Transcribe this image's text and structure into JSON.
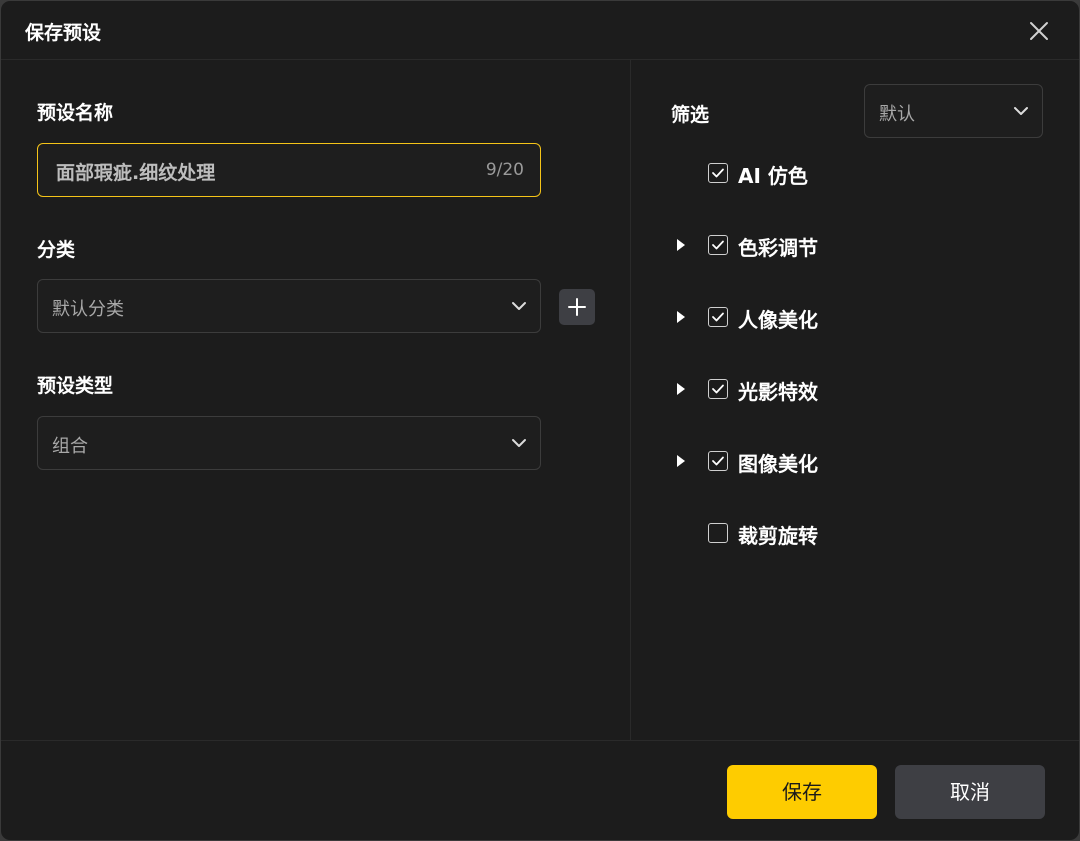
{
  "dialog": {
    "title": "保存预设"
  },
  "form": {
    "name_label": "预设名称",
    "name_value": "面部瑕疵.细纹处理",
    "name_counter": "9/20",
    "category_label": "分类",
    "category_value": "默认分类",
    "type_label": "预设类型",
    "type_value": "组合"
  },
  "filter": {
    "label": "筛选",
    "selected": "默认",
    "options": [
      {
        "label": "AI 仿色",
        "checked": true,
        "expandable": false
      },
      {
        "label": "色彩调节",
        "checked": true,
        "expandable": true
      },
      {
        "label": "人像美化",
        "checked": true,
        "expandable": true
      },
      {
        "label": "光影特效",
        "checked": true,
        "expandable": true
      },
      {
        "label": "图像美化",
        "checked": true,
        "expandable": true
      },
      {
        "label": "裁剪旋转",
        "checked": false,
        "expandable": false
      }
    ]
  },
  "footer": {
    "save_label": "保存",
    "cancel_label": "取消"
  },
  "colors": {
    "accent": "#fecc00",
    "background": "#1c1c1c",
    "focus_border": "#f5c418"
  }
}
